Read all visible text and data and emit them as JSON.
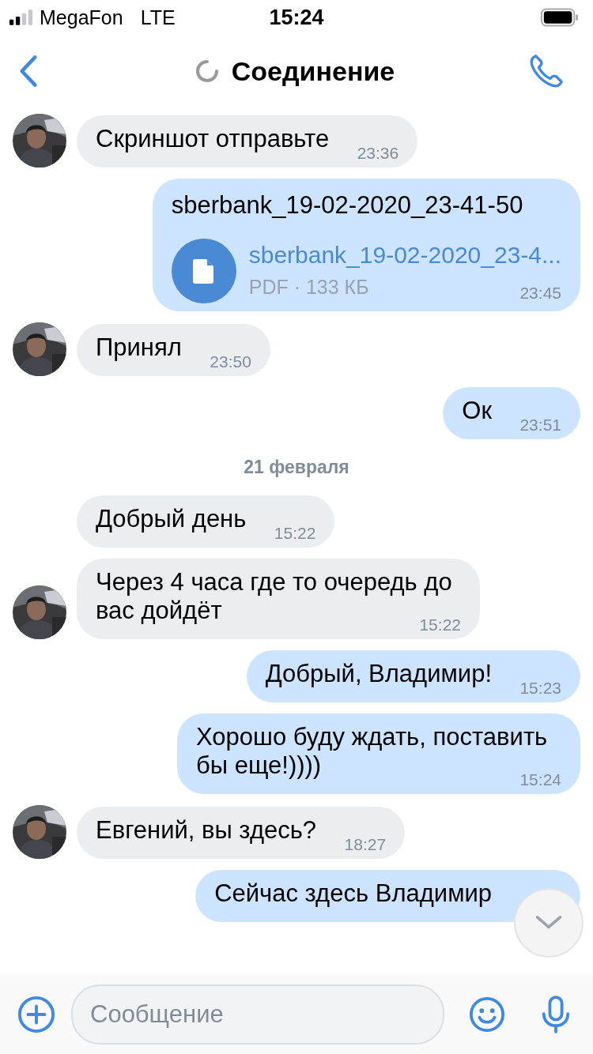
{
  "status_bar": {
    "carrier": "MegaFon",
    "network": "LTE",
    "time": "15:24"
  },
  "header": {
    "title": "Соединение"
  },
  "messages": [
    {
      "kind": "text",
      "outgoing": false,
      "avatar": true,
      "text": "Скриншот отправьте",
      "time": "23:36"
    },
    {
      "kind": "file",
      "outgoing": true,
      "text": "sberbank_19-02-2020_23-41-50",
      "file_name": "sberbank_19-02-2020_23-4...",
      "file_info": "PDF · 133 КБ",
      "time": "23:45"
    },
    {
      "kind": "text",
      "outgoing": false,
      "avatar": true,
      "text": "Принял",
      "time": "23:50"
    },
    {
      "kind": "text",
      "outgoing": true,
      "text": "Ок",
      "time": "23:51"
    },
    {
      "kind": "date",
      "text": "21 февраля"
    },
    {
      "kind": "text",
      "outgoing": false,
      "avatar": false,
      "text": "Добрый день",
      "time": "15:22"
    },
    {
      "kind": "text",
      "outgoing": false,
      "avatar": true,
      "text": "Через 4 часа где то очередь до вас дойдёт",
      "time": "15:22"
    },
    {
      "kind": "text",
      "outgoing": true,
      "text": "Добрый, Владимир!",
      "time": "15:23"
    },
    {
      "kind": "text",
      "outgoing": true,
      "text": "Хорошо буду ждать, поставить бы еще!))))",
      "time": "15:24"
    },
    {
      "kind": "text",
      "outgoing": false,
      "avatar": true,
      "text": "Евгений, вы здесь?",
      "time": "18:27"
    },
    {
      "kind": "text",
      "outgoing": true,
      "text": "Сейчас здесь Владимир"
    }
  ],
  "composer": {
    "placeholder": "Сообщение"
  }
}
